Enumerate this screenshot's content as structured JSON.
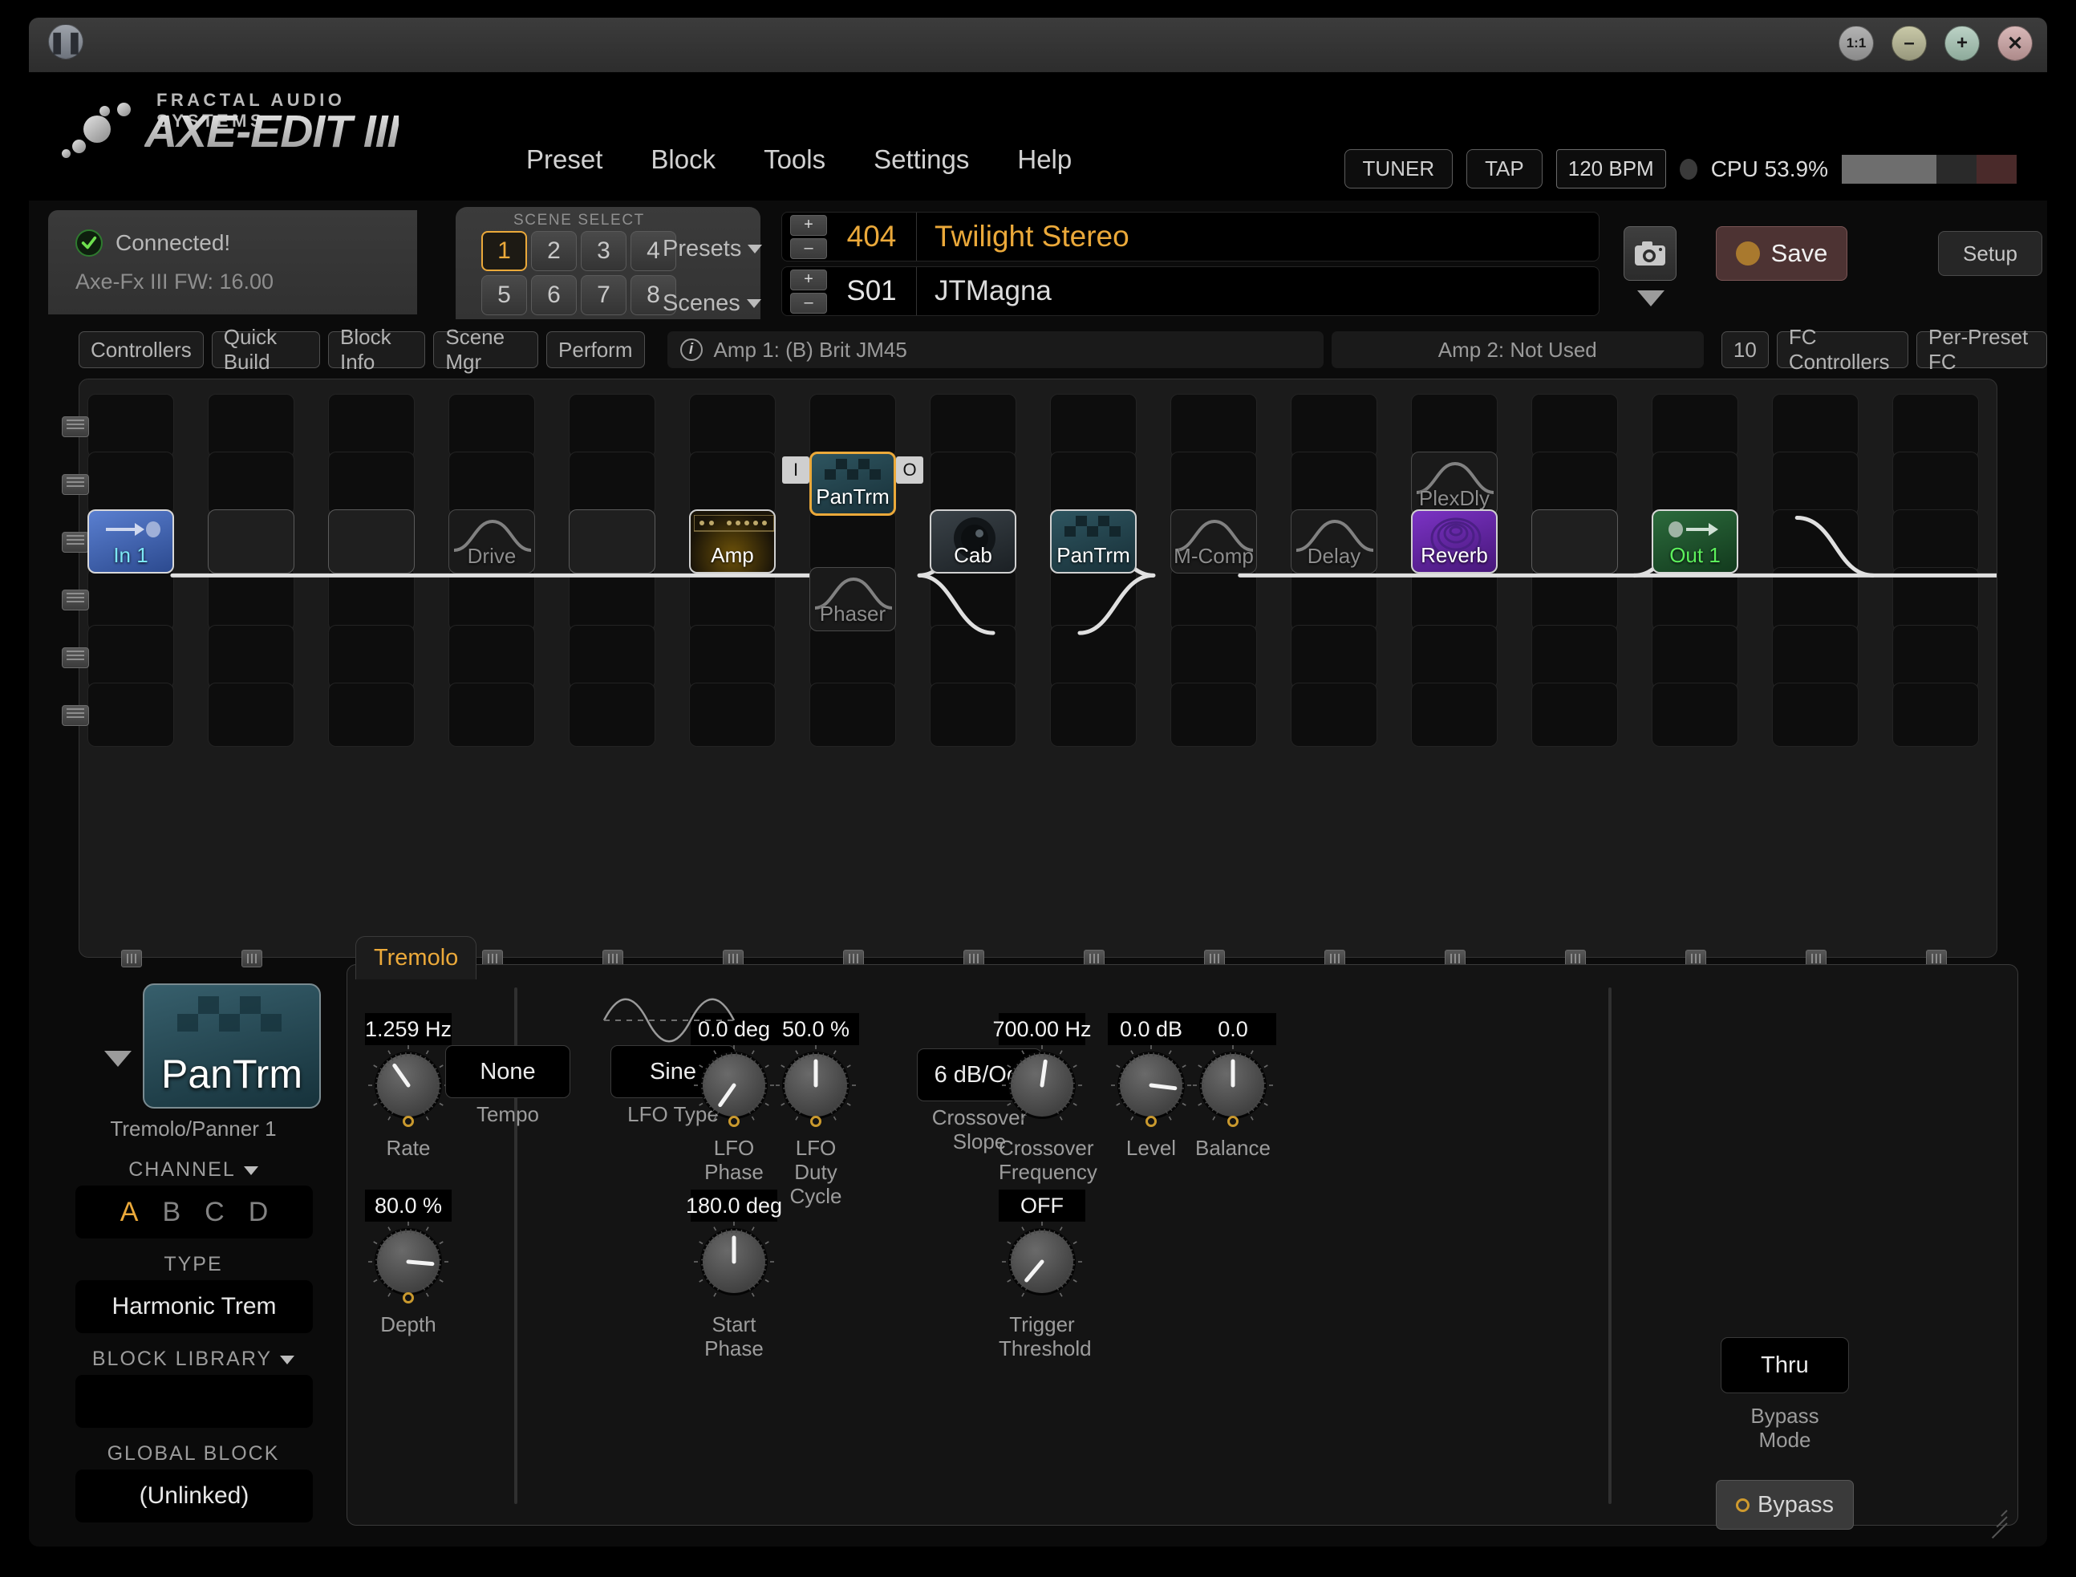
{
  "window": {
    "controls": [
      "pause-icon",
      "ratio-1-1-icon",
      "minimize-icon",
      "maximize-icon",
      "close-icon"
    ],
    "pause_glyph": "❚❚",
    "ratio_glyph": "1:1",
    "min_glyph": "–",
    "max_glyph": "+",
    "close_glyph": "✕"
  },
  "brand": {
    "tagline": "FRACTAL AUDIO SYSTEMS",
    "name": "AXE-EDIT III"
  },
  "menu": [
    "Preset",
    "Block",
    "Tools",
    "Settings",
    "Help"
  ],
  "topright": {
    "tuner": "TUNER",
    "tap": "TAP",
    "bpm": "120 BPM",
    "cpu": "CPU 53.9%",
    "cpu_percent": 53.9
  },
  "status": {
    "connected": "Connected!",
    "firmware": "Axe-Fx III FW: 16.00"
  },
  "scene_select": {
    "label": "SCENE SELECT",
    "buttons": [
      "1",
      "2",
      "3",
      "4",
      "5",
      "6",
      "7",
      "8"
    ],
    "active": "1"
  },
  "selectors": {
    "presets_label": "Presets",
    "scenes_label": "Scenes",
    "plus": "+",
    "minus": "–",
    "preset_number": "404",
    "preset_name": "Twilight Stereo",
    "scene_number": "S01",
    "scene_name": "JTMagna"
  },
  "actions": {
    "save": "Save",
    "setup": "Setup",
    "camera": "camera-icon"
  },
  "toolbar": {
    "buttons": [
      "Controllers",
      "Quick Build",
      "Block Info",
      "Scene Mgr",
      "Perform"
    ],
    "amp1": "Amp 1: (B) Brit JM45",
    "amp2": "Amp 2: Not Used",
    "count": "10",
    "fc_controllers": "FC Controllers",
    "per_preset_fc": "Per-Preset FC"
  },
  "grid": {
    "rows": 6,
    "cols": 16,
    "blocks": [
      {
        "label": "In 1",
        "col": 0,
        "row": 2,
        "kind": "in",
        "selected": false
      },
      {
        "label": "",
        "col": 1,
        "row": 2,
        "kind": "slot",
        "selected": false
      },
      {
        "label": "",
        "col": 2,
        "row": 2,
        "kind": "slot",
        "selected": false
      },
      {
        "label": "Drive",
        "col": 3,
        "row": 2,
        "kind": "ghost",
        "selected": false
      },
      {
        "label": "",
        "col": 4,
        "row": 2,
        "kind": "slot",
        "selected": false
      },
      {
        "label": "Amp",
        "col": 5,
        "row": 2,
        "kind": "amp",
        "selected": false
      },
      {
        "label": "PanTrm",
        "col": 6,
        "row": 1,
        "kind": "pan",
        "selected": true
      },
      {
        "label": "Phaser",
        "col": 6,
        "row": 3,
        "kind": "ghost",
        "selected": false
      },
      {
        "label": "Cab",
        "col": 7,
        "row": 2,
        "kind": "cab",
        "selected": false
      },
      {
        "label": "PanTrm",
        "col": 8,
        "row": 2,
        "kind": "pan",
        "selected": false
      },
      {
        "label": "M-Comp",
        "col": 9,
        "row": 2,
        "kind": "ghost",
        "selected": false
      },
      {
        "label": "Delay",
        "col": 10,
        "row": 2,
        "kind": "ghost",
        "selected": false
      },
      {
        "label": "PlexDly",
        "col": 11,
        "row": 1,
        "kind": "ghost",
        "selected": false
      },
      {
        "label": "Reverb",
        "col": 11,
        "row": 2,
        "kind": "rev",
        "selected": false
      },
      {
        "label": "",
        "col": 12,
        "row": 2,
        "kind": "slot",
        "selected": false
      },
      {
        "label": "Out 1",
        "col": 13,
        "row": 2,
        "kind": "out",
        "selected": false
      }
    ],
    "shunt_in_tag": "I",
    "shunt_out_tag": "O"
  },
  "block_panel": {
    "block_label": "PanTrm",
    "block_subtitle": "Tremolo/Panner 1",
    "channel_label": "CHANNEL",
    "channels": [
      "A",
      "B",
      "C",
      "D"
    ],
    "channel_active": "A",
    "type_label": "TYPE",
    "type_value": "Harmonic Trem",
    "library_label": "BLOCK LIBRARY",
    "library_value": "",
    "global_label": "GLOBAL BLOCK",
    "global_value": "(Unlinked)"
  },
  "editor": {
    "tab": "Tremolo",
    "controls": [
      {
        "name": "rate",
        "label": "Rate",
        "value": "1.259 Hz",
        "angle": -35,
        "type": "knob",
        "marker": true
      },
      {
        "name": "tempo",
        "label": "Tempo",
        "value": "None",
        "type": "select"
      },
      {
        "name": "lfo-type",
        "label": "LFO Type",
        "value": "Sine",
        "type": "select"
      },
      {
        "name": "lfo-phase",
        "label": "LFO Phase",
        "value": "0.0 deg",
        "angle": -145,
        "type": "knob",
        "marker": true
      },
      {
        "name": "lfo-duty",
        "label": "LFO Duty\nCycle",
        "value": "50.0 %",
        "angle": 0,
        "type": "knob",
        "marker": true
      },
      {
        "name": "xover-slope",
        "label": "Crossover\nSlope",
        "value": "6 dB/Oct",
        "type": "select"
      },
      {
        "name": "xover-freq",
        "label": "Crossover\nFrequency",
        "value": "700.00 Hz",
        "angle": 8,
        "type": "knob",
        "marker": false
      },
      {
        "name": "level",
        "label": "Level",
        "value": "0.0 dB",
        "angle": 97,
        "type": "knob",
        "marker": true
      },
      {
        "name": "balance",
        "label": "Balance",
        "value": "0.0",
        "angle": 0,
        "type": "knob",
        "marker": true
      },
      {
        "name": "depth",
        "label": "Depth",
        "value": "80.0 %",
        "angle": 95,
        "type": "knob",
        "marker": true
      },
      {
        "name": "start-phase",
        "label": "Start Phase",
        "value": "180.0 deg",
        "angle": 0,
        "type": "knob",
        "marker": false
      },
      {
        "name": "trigger-threshold",
        "label": "Trigger\nThreshold",
        "value": "OFF",
        "angle": -140,
        "type": "knob",
        "marker": false
      }
    ],
    "bypass_mode_value": "Thru",
    "bypass_mode_label": "Bypass\nMode",
    "bypass_button": "Bypass"
  }
}
